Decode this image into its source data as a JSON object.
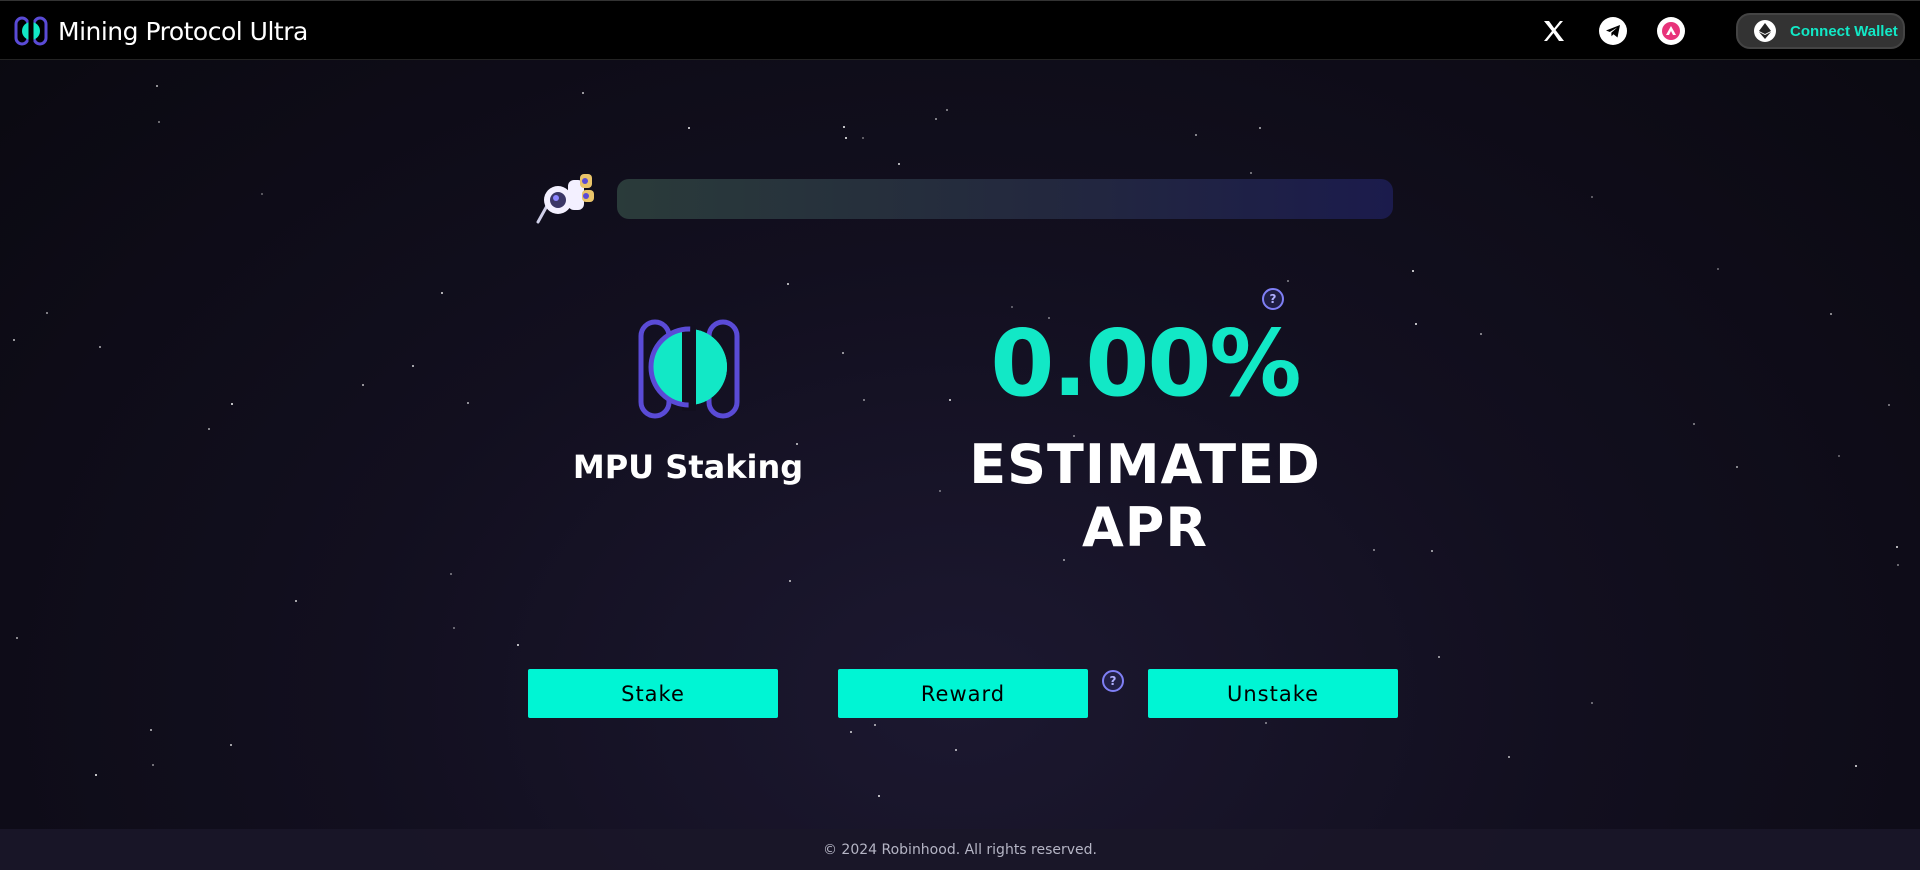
{
  "header": {
    "brand_name": "Mining Protocol Ultra",
    "social": [
      {
        "icon": "x-icon"
      },
      {
        "icon": "telegram-icon"
      },
      {
        "icon": "community-icon"
      }
    ],
    "wallet_label": "Connect Wallet"
  },
  "progress": {
    "fraction": 0.0
  },
  "staking": {
    "title": "MPU Staking"
  },
  "apr": {
    "value": "0.00%",
    "label": "ESTIMATED APR"
  },
  "actions": {
    "stake": "Stake",
    "reward": "Reward",
    "unstake": "Unstake"
  },
  "help_glyph": "?",
  "footer": {
    "copyright": "© 2024 Robinhood. All rights reserved."
  },
  "colors": {
    "accent": "#00f5d4",
    "logo_purple": "#5a4bd6"
  }
}
